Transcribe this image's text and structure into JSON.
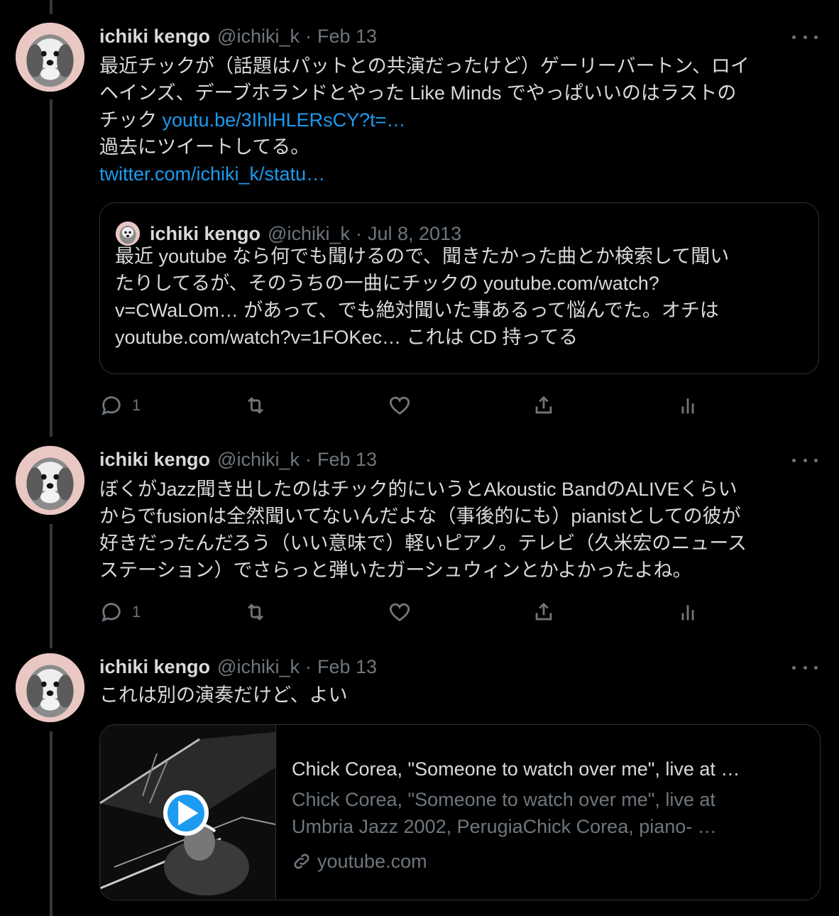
{
  "tweets": [
    {
      "name": "ichiki kengo",
      "handle": "@ichiki_k",
      "date": "Feb 13",
      "text_lines": [
        {
          "text": "最近チックが（話題はパットとの共演だったけど）ゲーリーバートン、ロイ"
        },
        {
          "text": "ヘインズ、デーブホランドとやった Like Minds でやっぱいいのはラストの"
        },
        {
          "text": "チック ",
          "link": "youtu.be/3IhlHLERsCY?t=…"
        },
        {
          "text": "過去にツイートしてる。"
        },
        {
          "text": "",
          "link": "twitter.com/ichiki_k/statu…"
        }
      ],
      "quote": {
        "name": "ichiki kengo",
        "handle": "@ichiki_k",
        "date": "Jul 8, 2013",
        "lines": [
          "最近 youtube なら何でも聞けるので、聞きたかった曲とか検索して聞い",
          "たりしてるが、そのうちの一曲にチックの youtube.com/watch?",
          "v=CWaLOm… があって、でも絶対聞いた事あるって悩んでた。オチは",
          "youtube.com/watch?v=1FOKec… これは CD 持ってる"
        ]
      },
      "reply_count": "1"
    },
    {
      "name": "ichiki kengo",
      "handle": "@ichiki_k",
      "date": "Feb 13",
      "text_lines": [
        {
          "text": "ぼくがJazz聞き出したのはチック的にいうとAkoustic BandのALIVEくらい"
        },
        {
          "text": "からでfusionは全然聞いてないんだよな（事後的にも）pianistとしての彼が"
        },
        {
          "text": "好きだったんだろう（いい意味で）軽いピアノ。テレビ（久米宏のニュース"
        },
        {
          "text": "ステーション）でさらっと弾いたガーシュウィンとかよかったよね。"
        }
      ],
      "reply_count": "1"
    },
    {
      "name": "ichiki kengo",
      "handle": "@ichiki_k",
      "date": "Feb 13",
      "text_lines": [
        {
          "text": "これは別の演奏だけど、よい"
        }
      ],
      "card": {
        "title": "Chick Corea, \"Someone to watch over me\", live at …",
        "desc_lines": [
          "Chick Corea, \"Someone to watch over me\", live at",
          "Umbria Jazz 2002, PerugiaChick Corea, piano- …"
        ],
        "domain": "youtube.com"
      }
    }
  ],
  "separator": "·",
  "icons": {
    "more": "more-dots-icon",
    "reply": "reply-icon",
    "retweet": "retweet-icon",
    "like": "like-icon",
    "share": "share-icon",
    "analytics": "analytics-icon",
    "play": "play-icon",
    "link": "link-icon"
  },
  "colors": {
    "background": "#000000",
    "text": "#d9d9d9",
    "muted": "#6e767d",
    "link": "#1d9bf0",
    "border": "#2f3336"
  }
}
